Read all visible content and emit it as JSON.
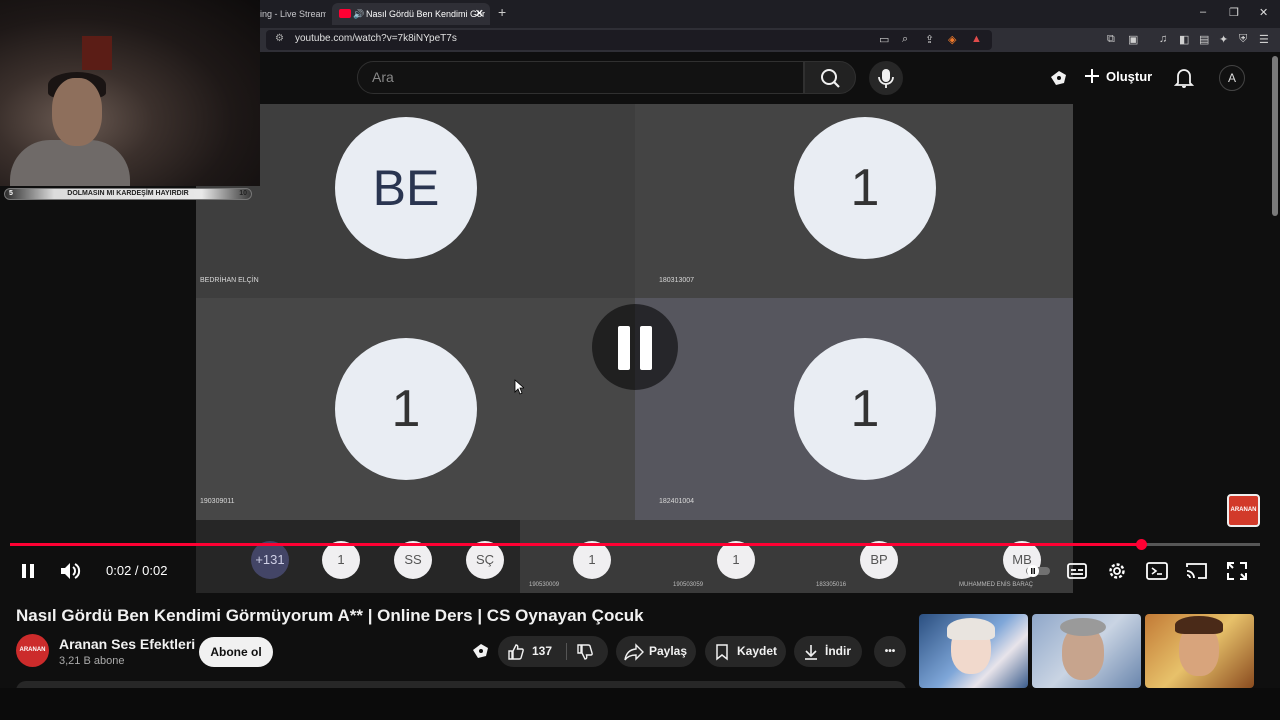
{
  "browser": {
    "tabs": [
      {
        "label": "ing - Live Stream"
      },
      {
        "label": "Nasıl Gördü Ben Kendimi Gör"
      }
    ],
    "new_tab_glyph": "+",
    "url": "youtube.com/watch?v=7k8iNYpeT7s",
    "window_controls": [
      "–",
      "❐",
      "✕"
    ]
  },
  "header": {
    "search_placeholder": "Ara",
    "create_label": "Oluştur",
    "avatar_letter": "A"
  },
  "webcam": {
    "bar_text": "DOLMASIN MI KARDEŞİM HAYIRDIR",
    "bar_left": "5",
    "bar_right": "10"
  },
  "video": {
    "tiles": [
      {
        "initials": "BE",
        "label": "BEDRİHAN ELÇİN"
      },
      {
        "initials": "1",
        "label": "180313007"
      },
      {
        "initials": "1",
        "label": "190309011"
      },
      {
        "initials": "1",
        "label": "182401004"
      }
    ],
    "strip": [
      {
        "initials": "+131",
        "label": ""
      },
      {
        "initials": "1",
        "label": ""
      },
      {
        "initials": "SS",
        "label": ""
      },
      {
        "initials": "SÇ",
        "label": ""
      },
      {
        "initials": "1",
        "label": "190530009"
      },
      {
        "initials": "1",
        "label": "190503059"
      },
      {
        "initials": "BP",
        "label": "183305016"
      },
      {
        "initials": "MB",
        "label": "MUHAMMED ENİS BARAÇ"
      }
    ],
    "badge_text": "ARANAN",
    "time": "0:02 / 0:02",
    "progress_fraction": 0.905
  },
  "details": {
    "title": "Nasıl Gördü Ben Kendimi Görmüyorum A** | Online Ders | CS Oynayan Çocuk",
    "channel_name": "Aranan Ses Efektleri",
    "channel_avatar_text": "ARANAN",
    "subscribers": "3,21 B abone",
    "subscribe_label": "Abone ol",
    "like_count": "137",
    "share_label": "Paylaş",
    "save_label": "Kaydet",
    "download_label": "İndir",
    "more_label": "•••"
  },
  "colors": {
    "accent": "#ff0033",
    "background": "#0f0f0f",
    "pill": "#272727"
  }
}
